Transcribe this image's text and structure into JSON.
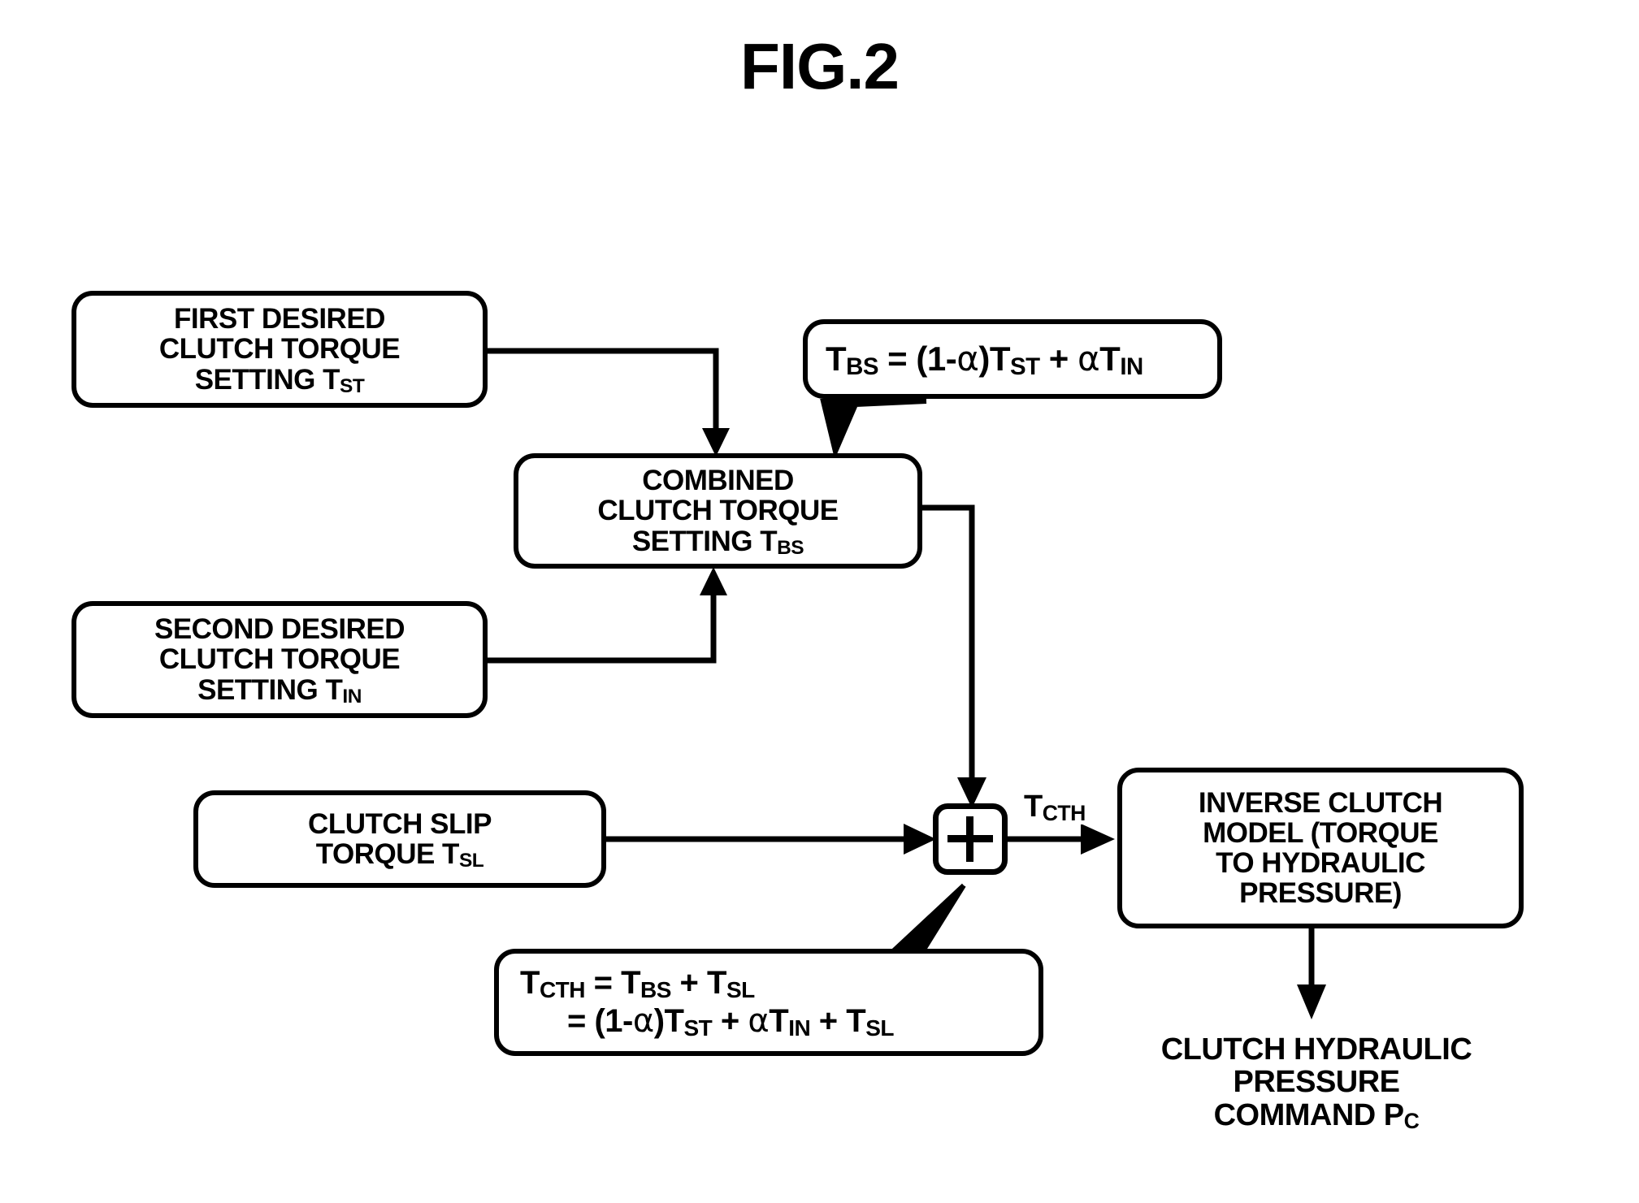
{
  "figure": {
    "title": "FIG.2",
    "type": "control-block-diagram",
    "ink_color": "#000000",
    "background_color": "#ffffff"
  },
  "blocks": {
    "first_desired": {
      "line1": "FIRST DESIRED",
      "line2": "CLUTCH TORQUE",
      "line3_prefix": "SETTING T",
      "line3_sub": "ST"
    },
    "second_desired": {
      "line1": "SECOND DESIRED",
      "line2": "CLUTCH TORQUE",
      "line3_prefix": "SETTING T",
      "line3_sub": "IN"
    },
    "combined": {
      "line1": "COMBINED",
      "line2": "CLUTCH TORQUE",
      "line3_prefix": "SETTING T",
      "line3_sub": "BS"
    },
    "clutch_slip": {
      "line1": "CLUTCH SLIP",
      "line2_prefix": "TORQUE T",
      "line2_sub": "SL"
    },
    "inverse_model": {
      "line1": "INVERSE CLUTCH",
      "line2": "MODEL (TORQUE",
      "line3": "TO HYDRAULIC",
      "line4": "PRESSURE)"
    },
    "output": {
      "line1": "CLUTCH HYDRAULIC",
      "line2": "PRESSURE",
      "line3_prefix": "COMMAND P",
      "line3_sub": "C"
    },
    "summing_junction": {
      "operator": "+"
    }
  },
  "callouts": {
    "tbs_formula": {
      "lhs": "T",
      "lhs_sub": "BS",
      "eq": " = (1-",
      "alpha1": "α",
      "mid": ")T",
      "tst_sub": "ST",
      "plus": " + ",
      "alpha2": "α",
      "tin": "T",
      "tin_sub": "IN",
      "full_text": "TBS = (1-α)TST + αTIN"
    },
    "tcth_formula": {
      "line1_lhs": "T",
      "line1_lhs_sub": "CTH",
      "line1_eq": " = T",
      "line1_bs_sub": "BS",
      "line1_plus": " + T",
      "line1_sl_sub": "SL",
      "line2_eq": "= (1-",
      "line2_alpha1": "α",
      "line2_mid": ")T",
      "line2_st_sub": "ST",
      "line2_plus1": " + ",
      "line2_alpha2": "α",
      "line2_tin": "T",
      "line2_in_sub": "IN",
      "line2_plus2": " + T",
      "line2_sl_sub": "SL",
      "full_text_line1": "TCTH = TBS + TSL",
      "full_text_line2": "= (1-α)TST + αTIN + TSL"
    }
  },
  "edge_labels": {
    "tcth": {
      "prefix": "T",
      "sub": "CTH"
    }
  }
}
